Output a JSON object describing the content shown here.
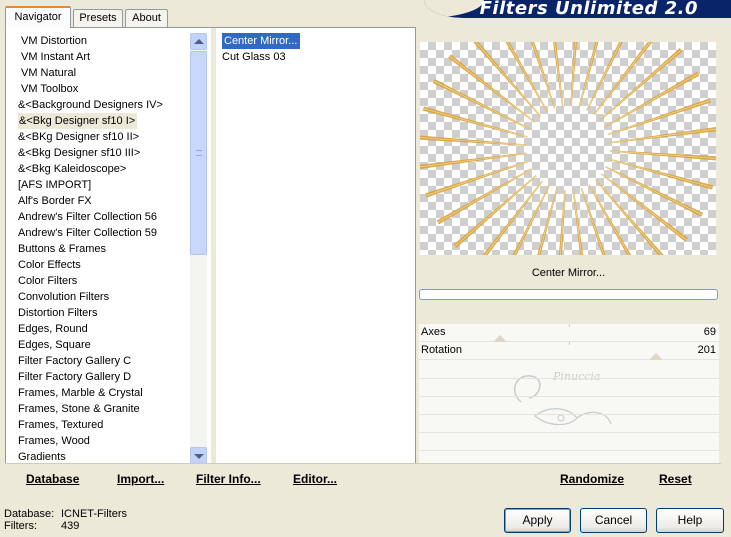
{
  "tabs": [
    {
      "label": "Navigator",
      "active": true
    },
    {
      "label": "Presets",
      "active": false
    },
    {
      "label": "About",
      "active": false
    }
  ],
  "logo": {
    "text": "Filters Unlimited 2.0"
  },
  "categories": [
    {
      "label": "VM Distortion"
    },
    {
      "label": "VM Instant Art"
    },
    {
      "label": "VM Natural"
    },
    {
      "label": "VM Toolbox"
    },
    {
      "label": "&<Background Designers IV>"
    },
    {
      "label": "&<Bkg Designer sf10 I>",
      "selected": true
    },
    {
      "label": "&<BKg Designer sf10 II>"
    },
    {
      "label": "&<Bkg Designer sf10 III>"
    },
    {
      "label": "&<Bkg Kaleidoscope>"
    },
    {
      "label": "[AFS IMPORT]"
    },
    {
      "label": "Alf's Border FX"
    },
    {
      "label": "Andrew's Filter Collection 56"
    },
    {
      "label": "Andrew's Filter Collection 59"
    },
    {
      "label": "Buttons & Frames"
    },
    {
      "label": "Color Effects"
    },
    {
      "label": "Color Filters"
    },
    {
      "label": "Convolution Filters"
    },
    {
      "label": "Distortion Filters"
    },
    {
      "label": "Edges, Round"
    },
    {
      "label": "Edges, Square"
    },
    {
      "label": "Filter Factory Gallery C"
    },
    {
      "label": "Filter Factory Gallery D"
    },
    {
      "label": "Frames, Marble & Crystal"
    },
    {
      "label": "Frames, Stone & Granite"
    },
    {
      "label": "Frames, Textured"
    },
    {
      "label": "Frames, Wood"
    },
    {
      "label": "Gradients"
    }
  ],
  "filters": [
    {
      "label": "Center Mirror...",
      "selected": true
    },
    {
      "label": "Cut Glass  03"
    }
  ],
  "bottom_links": {
    "database": "Database",
    "import": "Import...",
    "filter_info": "Filter Info...",
    "editor": "Editor...",
    "randomize": "Randomize",
    "reset": "Reset"
  },
  "preview": {
    "filter_name": "Center Mirror...",
    "progress": 0
  },
  "params": [
    {
      "label": "Axes",
      "value": "69",
      "level": 0.27
    },
    {
      "label": "Rotation",
      "value": "201",
      "level": 0.79
    }
  ],
  "watermark": {
    "text": "Pinuccia"
  },
  "status": {
    "database_label": "Database:",
    "database_value": "ICNET-Filters",
    "filters_label": "Filters:",
    "filters_value": "439"
  },
  "buttons": {
    "apply": "Apply",
    "cancel": "Cancel",
    "help": "Help"
  },
  "colors": {
    "selection": "#316ac5",
    "accent_tab": "#e68b2c",
    "logo_bg": "#0a246a",
    "ray_gold": "#d9a23a"
  }
}
